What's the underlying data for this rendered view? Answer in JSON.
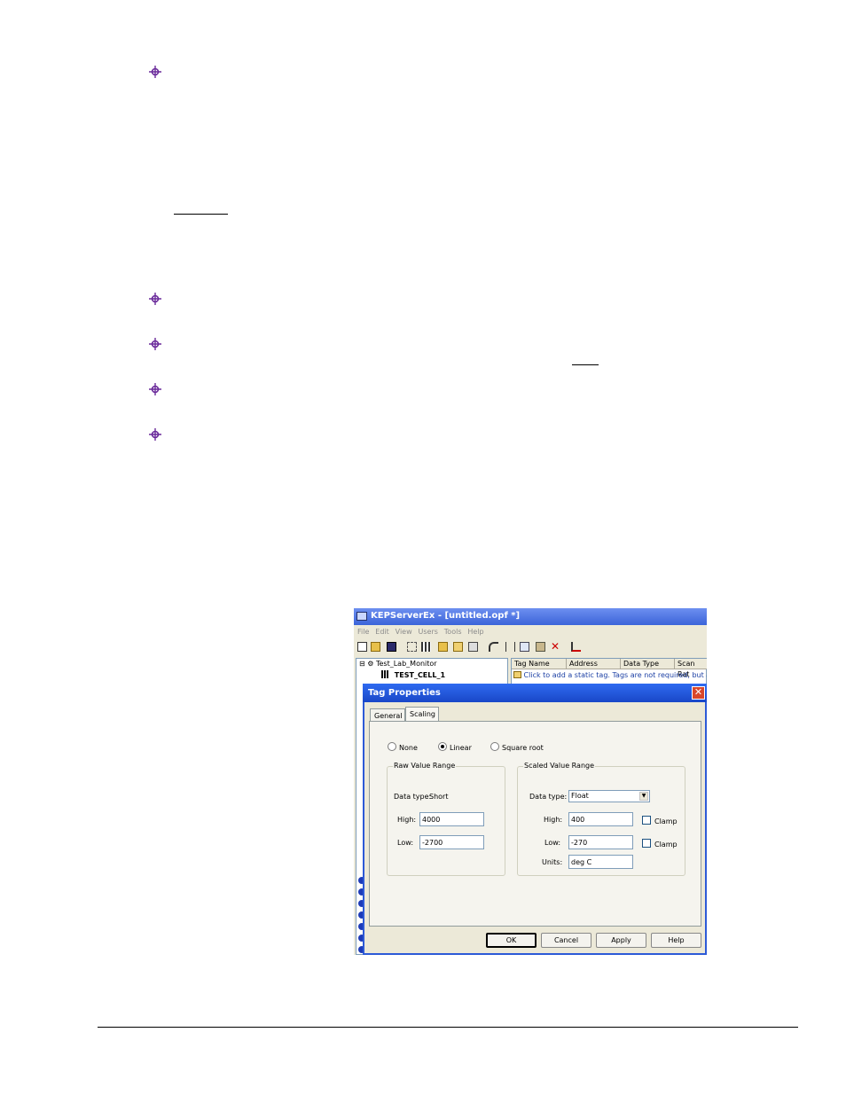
{
  "app": {
    "title": "KEPServerEx - [untitled.opf *]",
    "menu": [
      "File",
      "Edit",
      "View",
      "Users",
      "Tools",
      "Help"
    ],
    "tree": {
      "project": "Test_Lab_Monitor",
      "device": "TEST_CELL_1"
    },
    "columns": [
      "Tag Name",
      "Address",
      "Data Type",
      "Scan Rat"
    ],
    "hint_row": "Click to add a static tag.  Tags are not required, but are"
  },
  "dialog": {
    "title": "Tag Properties",
    "close_glyph": "✕",
    "tabs": [
      "General",
      "Scaling"
    ],
    "active_tab": "Scaling",
    "scaling_options": [
      "None",
      "Linear",
      "Square root"
    ],
    "selected_option": "Linear",
    "raw": {
      "legend": "Raw Value Range",
      "data_type_label": "Data type:",
      "data_type_value": "Short",
      "high_label": "High:",
      "high_value": "4000",
      "low_label": "Low:",
      "low_value": "-2700"
    },
    "scaled": {
      "legend": "Scaled Value Range",
      "data_type_label": "Data type:",
      "data_type_value": "Float",
      "high_label": "High:",
      "high_value": "400",
      "high_clamp": "Clamp",
      "low_label": "Low:",
      "low_value": "-270",
      "low_clamp": "Clamp",
      "units_label": "Units:",
      "units_value": "deg C"
    },
    "buttons": {
      "ok": "OK",
      "cancel": "Cancel",
      "apply": "Apply",
      "help": "Help"
    }
  },
  "colors": {
    "bullet": "#6a2a9a",
    "title_bar": "#2f6bf0",
    "window_face": "#ece9d8"
  }
}
